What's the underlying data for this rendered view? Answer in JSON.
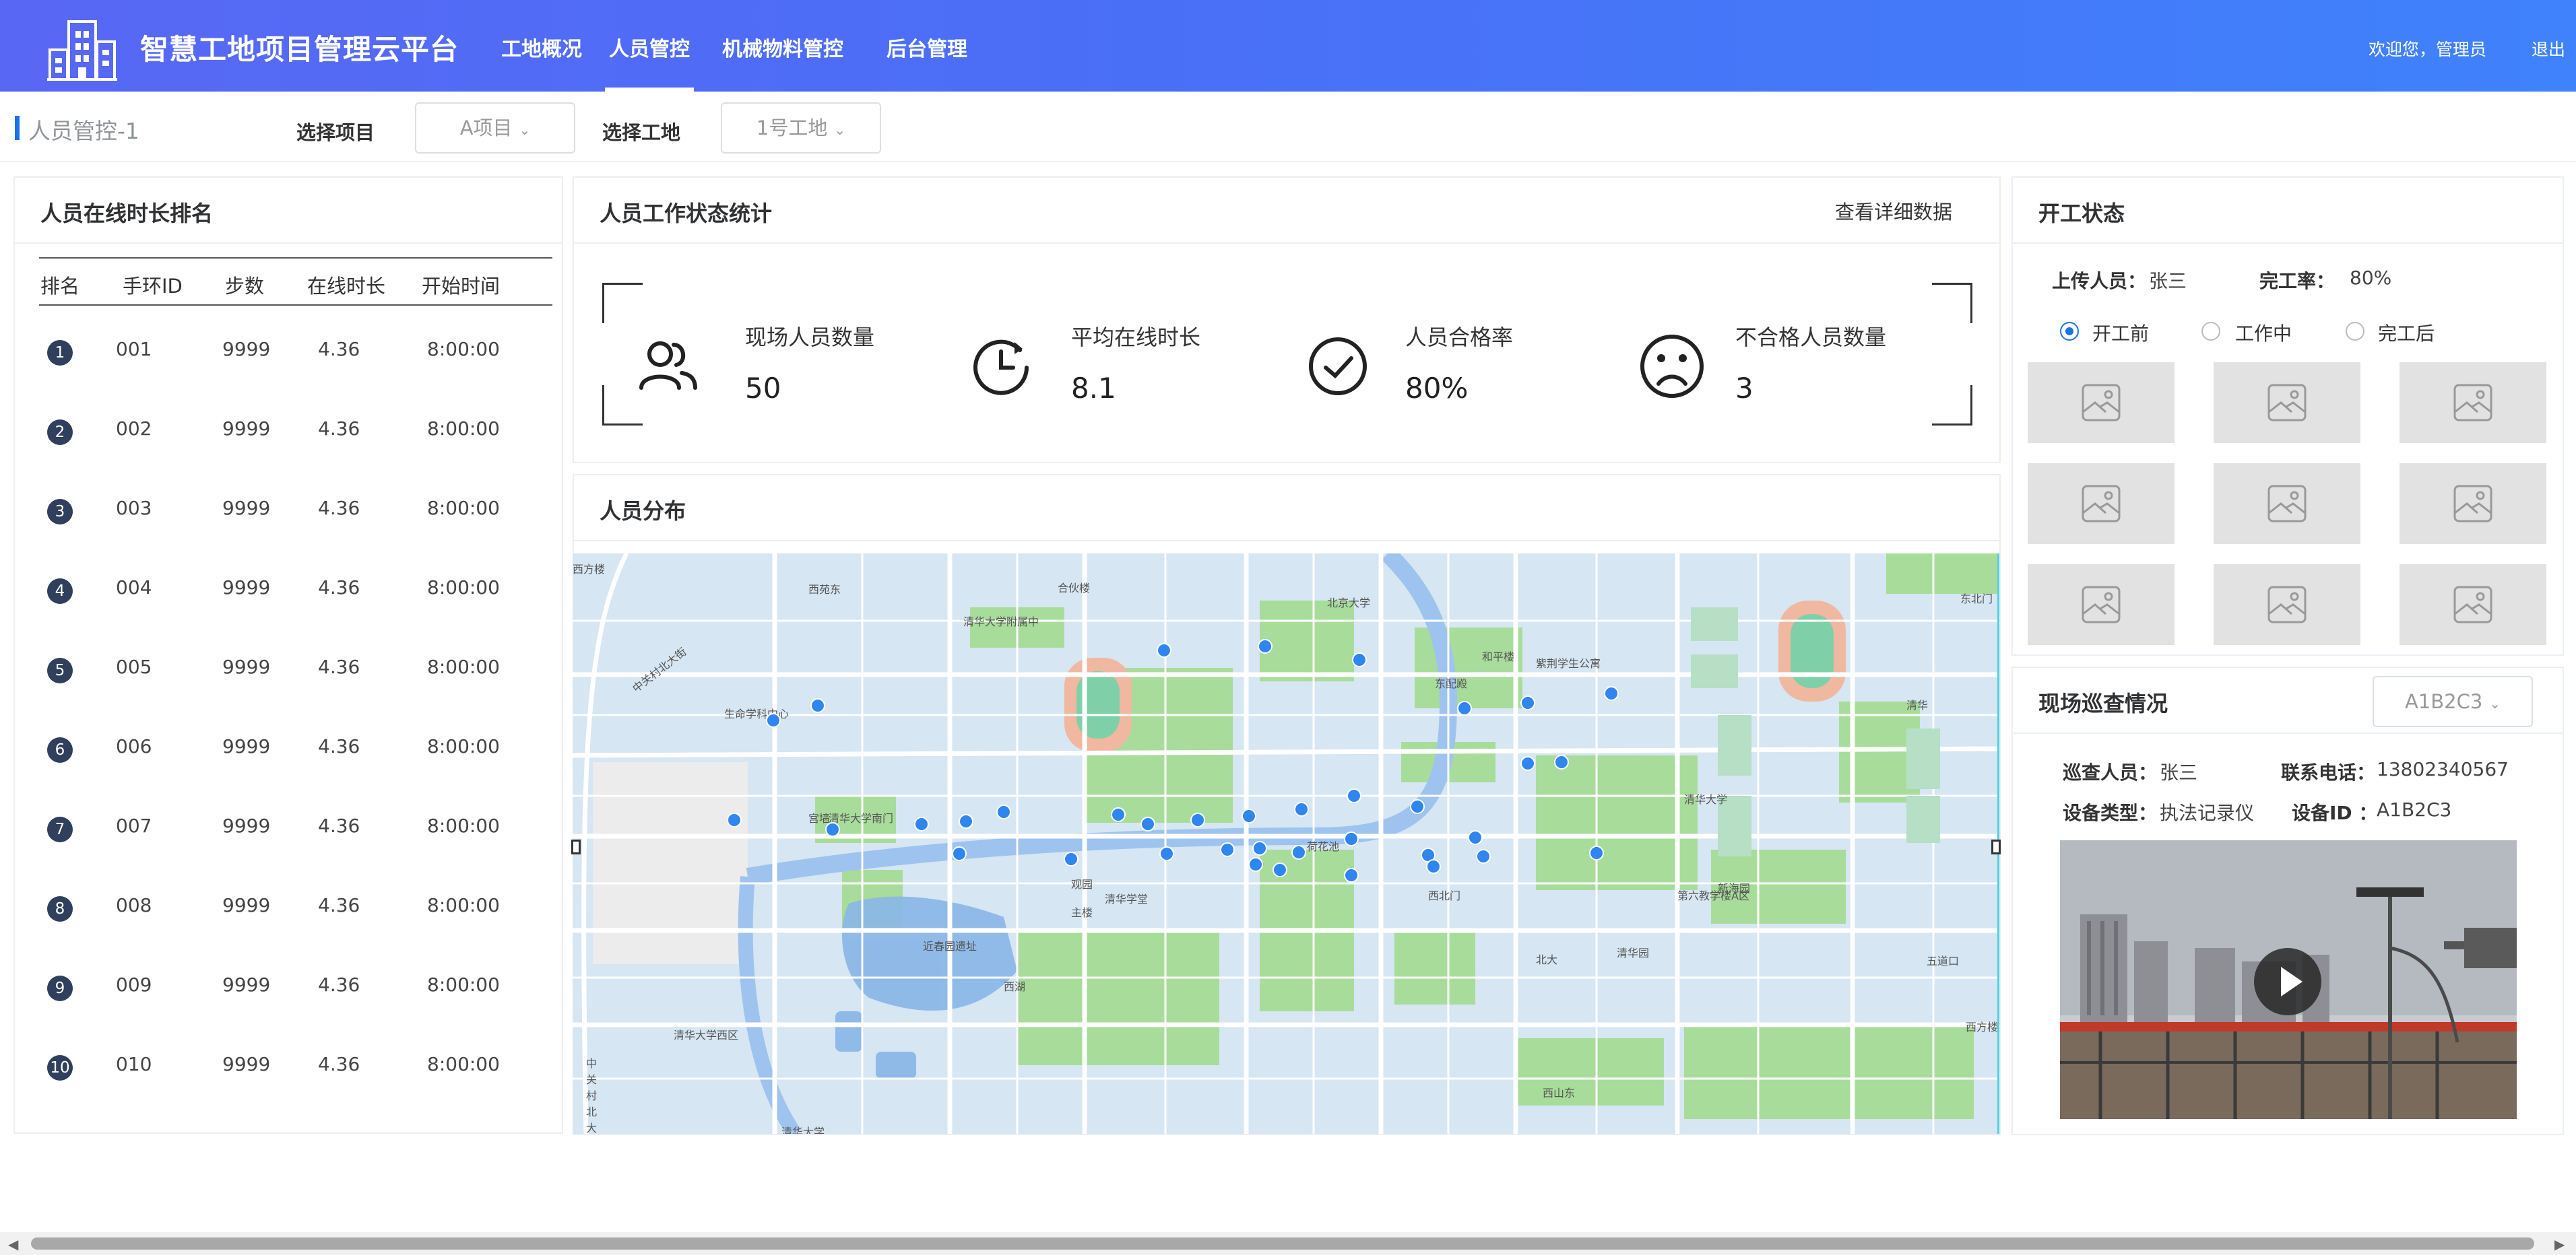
{
  "header": {
    "title": "智慧工地项目管理云平台",
    "nav": [
      "工地概况",
      "人员管控",
      "机械物料管控",
      "后台管理"
    ],
    "active_nav": "人员管控",
    "welcome": "欢迎您，管理员",
    "logout": "退出"
  },
  "subbar": {
    "title": "人员管控-1",
    "project_label": "选择项目",
    "project_value": "A项目",
    "site_label": "选择工地",
    "site_value": "1号工地"
  },
  "ranking": {
    "title": "人员在线时长排名",
    "columns": [
      "排名",
      "手环ID",
      "步数",
      "在线时长",
      "开始时间"
    ],
    "rows": [
      {
        "rank": "1",
        "id": "001",
        "steps": "9999",
        "hours": "4.36",
        "start": "8:00:00"
      },
      {
        "rank": "2",
        "id": "002",
        "steps": "9999",
        "hours": "4.36",
        "start": "8:00:00"
      },
      {
        "rank": "3",
        "id": "003",
        "steps": "9999",
        "hours": "4.36",
        "start": "8:00:00"
      },
      {
        "rank": "4",
        "id": "004",
        "steps": "9999",
        "hours": "4.36",
        "start": "8:00:00"
      },
      {
        "rank": "5",
        "id": "005",
        "steps": "9999",
        "hours": "4.36",
        "start": "8:00:00"
      },
      {
        "rank": "6",
        "id": "006",
        "steps": "9999",
        "hours": "4.36",
        "start": "8:00:00"
      },
      {
        "rank": "7",
        "id": "007",
        "steps": "9999",
        "hours": "4.36",
        "start": "8:00:00"
      },
      {
        "rank": "8",
        "id": "008",
        "steps": "9999",
        "hours": "4.36",
        "start": "8:00:00"
      },
      {
        "rank": "9",
        "id": "009",
        "steps": "9999",
        "hours": "4.36",
        "start": "8:00:00"
      },
      {
        "rank": "10",
        "id": "010",
        "steps": "9999",
        "hours": "4.36",
        "start": "8:00:00"
      }
    ]
  },
  "work_stats": {
    "title": "人员工作状态统计",
    "detail_link": "查看详细数据",
    "stats": [
      {
        "label": "现场人员数量",
        "value": "50",
        "icon": "people-icon"
      },
      {
        "label": "平均在线时长",
        "value": "8.1",
        "icon": "clock-icon"
      },
      {
        "label": "人员合格率",
        "value": "80%",
        "icon": "check-circle-icon"
      },
      {
        "label": "不合格人员数量",
        "value": "3",
        "icon": "sad-face-icon"
      }
    ]
  },
  "distribution": {
    "title": "人员分布",
    "map_labels": [
      "西苑东",
      "合伙楼",
      "紫荆学生公寓",
      "清华大学附属中",
      "清华大学南门",
      "中关村北大街",
      "生命学科中心",
      "近春园遗址",
      "西湖",
      "清华大学西区",
      "北大",
      "五道口",
      "西山东",
      "新海园",
      "第六教学楼A区",
      "西北门",
      "清华大学",
      "观园",
      "中关村北大街",
      "宫墙",
      "荷花池",
      "清华学堂",
      "主楼",
      "北京大学",
      "东配殿",
      "和平楼",
      "西方楼",
      "西方楼东",
      "东北门",
      "清华大学",
      "清华园",
      "清华"
    ],
    "accent_color": "#2f86f0"
  },
  "open_status": {
    "title": "开工状态",
    "uploader_label": "上传人员：",
    "uploader": "张三",
    "completion_label": "完工率：",
    "completion": "80%",
    "options": [
      "开工前",
      "工作中",
      "完工后"
    ],
    "selected": "开工前"
  },
  "inspection": {
    "title": "现场巡查情况",
    "device_select": "A1B2C3",
    "inspector_label": "巡查人员：",
    "inspector": "张三",
    "phone_label": "联系电话：",
    "phone": "13802340567",
    "device_type_label": "设备类型：",
    "device_type": "执法记录仪",
    "device_id_label": "设备ID ：",
    "device_id": "A1B2C3"
  }
}
